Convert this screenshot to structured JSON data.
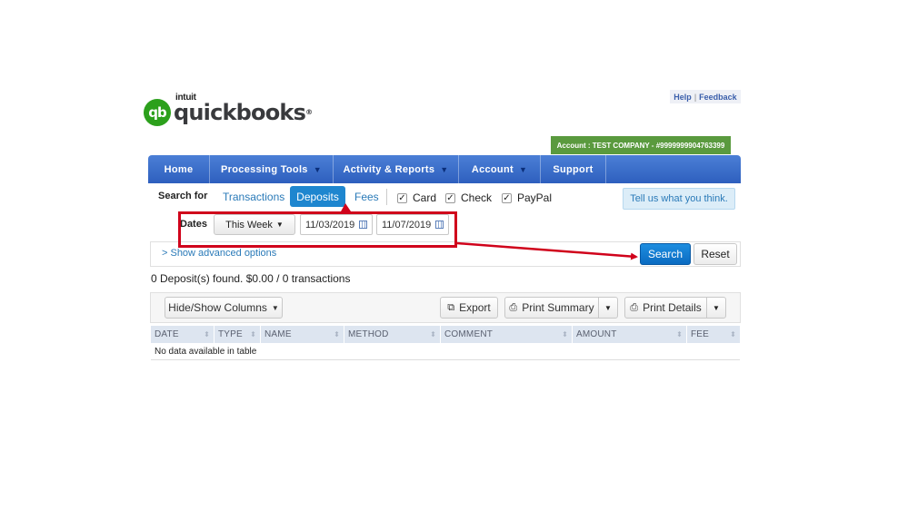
{
  "logo": {
    "mark": "qb",
    "intuit": "intuit",
    "wordmark": "quickbooks",
    "reg": "®"
  },
  "help_links": {
    "help": "Help",
    "separator": "|",
    "feedback": "Feedback"
  },
  "account_bar": {
    "text": "Account : TEST COMPANY - #9999999904763399"
  },
  "nav": {
    "home": "Home",
    "processing_tools": "Processing Tools",
    "activity_reports": "Activity & Reports",
    "account": "Account",
    "support": "Support",
    "caret": "▼"
  },
  "search": {
    "label": "Search for",
    "tabs": {
      "transactions": "Transactions",
      "deposits": "Deposits",
      "fees": "Fees"
    },
    "filters": {
      "card": "Card",
      "check": "Check",
      "paypal": "PayPal"
    },
    "feedback_button": "Tell us what you think.",
    "dates_label": "Dates",
    "date_range": "This Week",
    "start_date": "11/03/2019",
    "end_date": "11/07/2019",
    "advanced_link": "> Show advanced options",
    "search_button": "Search",
    "reset_button": "Reset"
  },
  "results": {
    "summary": "0 Deposit(s) found. $0.00 / 0 transactions"
  },
  "toolbar": {
    "hide_show": "Hide/Show Columns",
    "export": "Export",
    "print_summary": "Print Summary",
    "print_details": "Print Details"
  },
  "table": {
    "columns": [
      "DATE",
      "TYPE",
      "NAME",
      "METHOD",
      "COMMENT",
      "AMOUNT",
      "FEE"
    ],
    "empty_message": "No data available in table"
  },
  "colors": {
    "nav_blue": "#2e5fbe",
    "account_green": "#5a9a3e",
    "active_tab": "#1e86cf",
    "annotation_red": "#d0021b"
  }
}
